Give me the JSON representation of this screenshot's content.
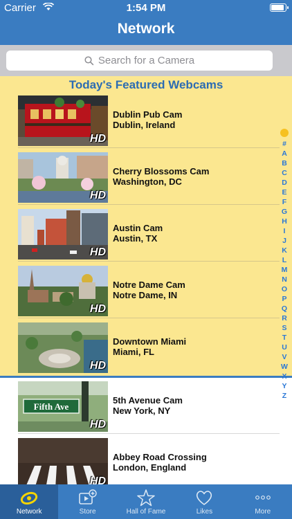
{
  "status_bar": {
    "carrier": "Carrier",
    "time": "1:54 PM"
  },
  "nav": {
    "title": "Network"
  },
  "search": {
    "placeholder": "Search for a Camera"
  },
  "featured": {
    "title": "Today's Featured Webcams",
    "items": [
      {
        "name": "Dublin Pub Cam",
        "location": "Dublin, Ireland",
        "badge": "HD"
      },
      {
        "name": "Cherry Blossoms Cam",
        "location": "Washington, DC",
        "badge": "HD"
      },
      {
        "name": "Austin Cam",
        "location": "Austin, TX",
        "badge": "HD"
      },
      {
        "name": "Notre Dame Cam",
        "location": "Notre Dame, IN",
        "badge": "HD"
      },
      {
        "name": "Downtown Miami",
        "location": "Miami, FL",
        "badge": "HD"
      }
    ]
  },
  "list": {
    "items": [
      {
        "name": "5th Avenue Cam",
        "location": "New York, NY",
        "badge": "HD",
        "sign_text": "Fifth Ave"
      },
      {
        "name": "Abbey Road Crossing",
        "location": "London, England",
        "badge": "HD"
      }
    ]
  },
  "index": {
    "letters": [
      "#",
      "A",
      "B",
      "C",
      "D",
      "E",
      "F",
      "G",
      "H",
      "I",
      "J",
      "K",
      "L",
      "M",
      "N",
      "O",
      "P",
      "Q",
      "R",
      "S",
      "T",
      "U",
      "V",
      "W",
      "X",
      "Y",
      "Z"
    ]
  },
  "tabs": [
    {
      "label": "Network",
      "icon": "network-icon",
      "active": true
    },
    {
      "label": "Store",
      "icon": "store-icon",
      "active": false
    },
    {
      "label": "Hall of Fame",
      "icon": "star-icon",
      "active": false
    },
    {
      "label": "Likes",
      "icon": "heart-icon",
      "active": false
    },
    {
      "label": "More",
      "icon": "more-icon",
      "active": false
    }
  ],
  "colors": {
    "accent": "#3a7cc1",
    "featured_bg": "#fbe790",
    "index_letters": "#2b78d6"
  }
}
